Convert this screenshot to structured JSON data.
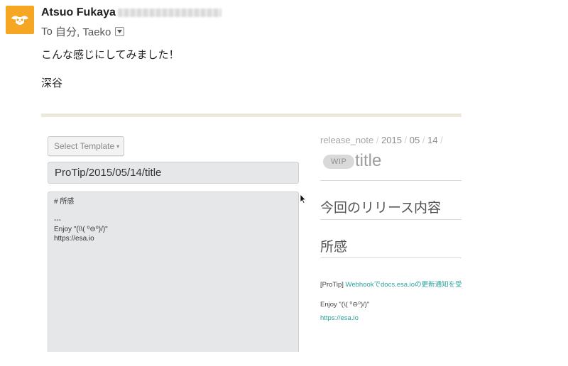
{
  "email": {
    "sender_name": "Atsuo Fukaya",
    "recipients_prefix": "To",
    "recipients": "自分, Taeko",
    "body_lines": [
      "こんな感じにしてみました！",
      "深谷"
    ],
    "avatar_color": "#f5a623"
  },
  "screenshot": {
    "template_button_label": "Select Template",
    "title_field_value": "ProTip/2015/05/14/title",
    "editor_lines": [
      "# 所感",
      "",
      "---",
      "Enjoy \"(\\\\( ⁰⊖⁰)/)\"",
      "https://esa.io"
    ],
    "breadcrumb": {
      "category": "release_note",
      "year": "2015",
      "month": "05",
      "day": "14"
    },
    "wip_badge": "WIP",
    "preview_title": "title",
    "preview_headings": [
      "今回のリリース内容",
      "所感"
    ],
    "protip_prefix": "[ProTip]",
    "protip_link": "Webhookでdocs.esa.ioの更新通知を受",
    "enjoy_line": "Enjoy \"(\\( ⁰⊖⁰)/)\"",
    "esa_link": "https://esa.io",
    "link_color": "#2aa39a",
    "top_bar_color": "#ece9dc",
    "editor_background": "#e6e7e9"
  }
}
